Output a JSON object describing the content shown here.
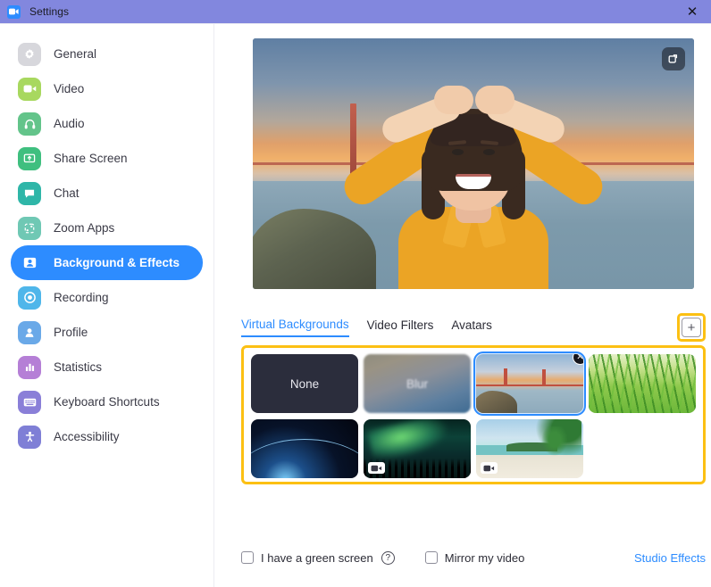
{
  "window": {
    "title": "Settings",
    "app_icon": "zoom-video-icon",
    "close_label": "✕",
    "titlebar_color": "#8287de"
  },
  "sidebar": {
    "items": [
      {
        "label": "General",
        "icon": "gear-icon",
        "icon_bg": "#d7d7dc",
        "icon_fg": "#ffffff",
        "active": false
      },
      {
        "label": "Video",
        "icon": "video-camera-icon",
        "icon_bg": "#a8d85f",
        "icon_fg": "#ffffff",
        "active": false
      },
      {
        "label": "Audio",
        "icon": "headphones-icon",
        "icon_bg": "#63c48a",
        "icon_fg": "#ffffff",
        "active": false
      },
      {
        "label": "Share Screen",
        "icon": "share-screen-icon",
        "icon_bg": "#3fbf7f",
        "icon_fg": "#ffffff",
        "active": false
      },
      {
        "label": "Chat",
        "icon": "chat-bubble-icon",
        "icon_bg": "#2fb6a8",
        "icon_fg": "#ffffff",
        "active": false
      },
      {
        "label": "Zoom Apps",
        "icon": "zoom-apps-icon",
        "icon_bg": "#6fc8b4",
        "icon_fg": "#ffffff",
        "active": false
      },
      {
        "label": "Background & Effects",
        "icon": "person-card-icon",
        "icon_bg": "#2d8cff",
        "icon_fg": "#ffffff",
        "active": true
      },
      {
        "label": "Recording",
        "icon": "record-circle-icon",
        "icon_bg": "#4fb6ea",
        "icon_fg": "#ffffff",
        "active": false
      },
      {
        "label": "Profile",
        "icon": "person-icon",
        "icon_bg": "#6aa9e8",
        "icon_fg": "#ffffff",
        "active": false
      },
      {
        "label": "Statistics",
        "icon": "bar-chart-icon",
        "icon_bg": "#b57fd6",
        "icon_fg": "#ffffff",
        "active": false
      },
      {
        "label": "Keyboard Shortcuts",
        "icon": "keyboard-icon",
        "icon_bg": "#8a7fd8",
        "icon_fg": "#ffffff",
        "active": false
      },
      {
        "label": "Accessibility",
        "icon": "accessibility-icon",
        "icon_bg": "#7f7fd6",
        "icon_fg": "#ffffff",
        "active": false
      }
    ],
    "active_color": "#2d8cff"
  },
  "preview": {
    "rotate_button_name": "rotate-camera-button",
    "description": "Live camera preview with Golden Gate Bridge virtual background"
  },
  "tabs": {
    "items": [
      {
        "label": "Virtual Backgrounds",
        "active": true
      },
      {
        "label": "Video Filters",
        "active": false
      },
      {
        "label": "Avatars",
        "active": false
      }
    ],
    "add_button_label": "+",
    "highlight_color": "#fcc013"
  },
  "backgrounds": {
    "highlight_color": "#fcc013",
    "selected_index": 2,
    "items": [
      {
        "name": "None",
        "label": "None",
        "art": "bg-none",
        "selected": false,
        "video": false,
        "removable": false
      },
      {
        "name": "Blur",
        "label": "Blur",
        "art": "bg-blur",
        "selected": false,
        "video": false,
        "removable": false
      },
      {
        "name": "Golden Gate Bridge",
        "label": "",
        "art": "bg-bridge",
        "selected": true,
        "video": false,
        "removable": true
      },
      {
        "name": "Grass",
        "label": "",
        "art": "bg-grass",
        "selected": false,
        "video": false,
        "removable": false
      },
      {
        "name": "Earth from Space",
        "label": "",
        "art": "bg-space",
        "selected": false,
        "video": false,
        "removable": false
      },
      {
        "name": "Aurora Borealis",
        "label": "",
        "art": "bg-aurora",
        "selected": false,
        "video": true,
        "removable": false
      },
      {
        "name": "Tropical Beach",
        "label": "",
        "art": "bg-beach",
        "selected": false,
        "video": true,
        "removable": false
      }
    ],
    "remove_badge_label": "✕"
  },
  "footer": {
    "green_screen_label": "I have a green screen",
    "green_screen_checked": false,
    "help_label": "?",
    "mirror_label": "Mirror my video",
    "mirror_checked": false,
    "studio_effects_label": "Studio Effects",
    "link_color": "#2d8cff"
  }
}
